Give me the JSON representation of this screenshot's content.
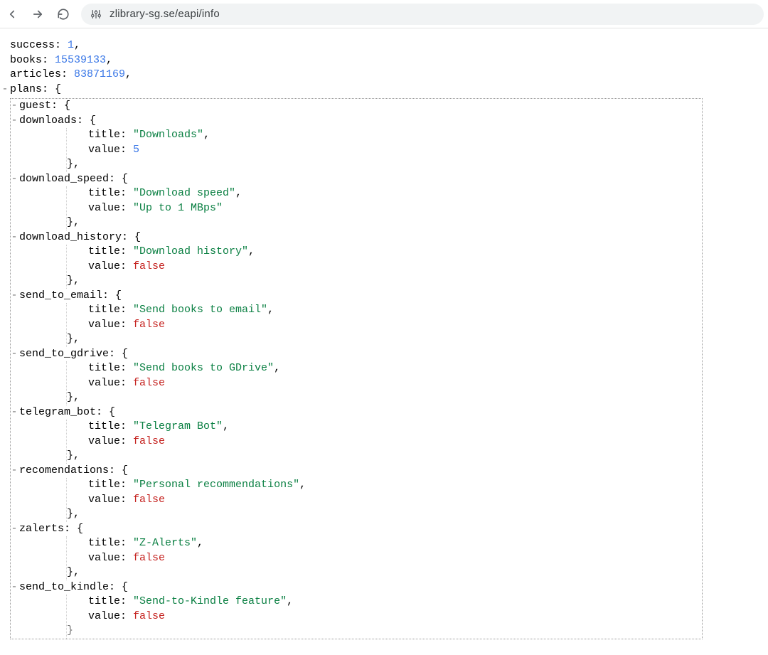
{
  "browser": {
    "url": "zlibrary-sg.se/eapi/info"
  },
  "json": {
    "success": 1,
    "books": 15539133,
    "articles": 83871169,
    "plans_key": "plans",
    "guest_key": "guest",
    "guest": [
      {
        "k": "downloads",
        "title": "Downloads",
        "vtype": "num",
        "value": 5
      },
      {
        "k": "download_speed",
        "title": "Download speed",
        "vtype": "str",
        "value": "Up to 1 MBps"
      },
      {
        "k": "download_history",
        "title": "Download history",
        "vtype": "bool",
        "value": false
      },
      {
        "k": "send_to_email",
        "title": "Send books to email",
        "vtype": "bool",
        "value": false
      },
      {
        "k": "send_to_gdrive",
        "title": "Send books to GDrive",
        "vtype": "bool",
        "value": false
      },
      {
        "k": "telegram_bot",
        "title": "Telegram Bot",
        "vtype": "bool",
        "value": false
      },
      {
        "k": "recomendations",
        "title": "Personal recommendations",
        "vtype": "bool",
        "value": false
      },
      {
        "k": "zalerts",
        "title": "Z-Alerts",
        "vtype": "bool",
        "value": false
      },
      {
        "k": "send_to_kindle",
        "title": "Send-to-Kindle feature",
        "vtype": "bool",
        "value": false
      }
    ]
  }
}
